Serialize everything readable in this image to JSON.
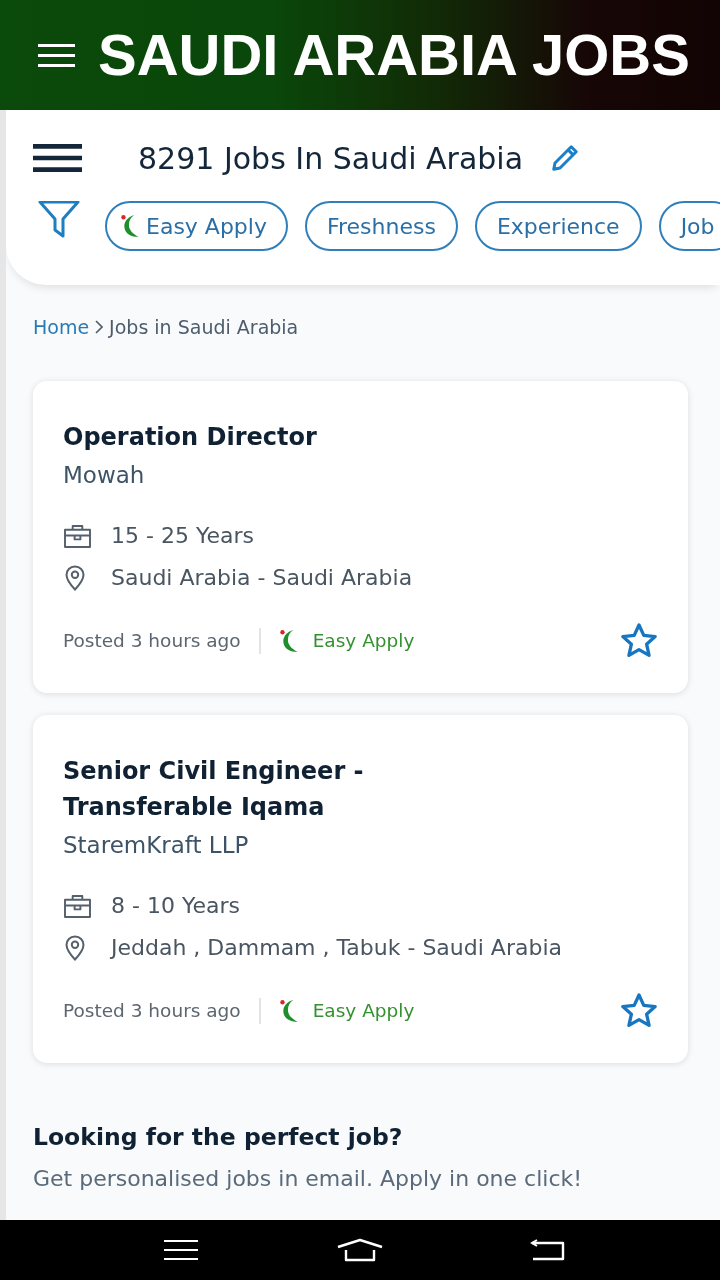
{
  "app_bar": {
    "title": "SAUDI ARABIA JOBS"
  },
  "header": {
    "title": "8291 Jobs In Saudi Arabia",
    "filters": [
      {
        "label": "Easy Apply",
        "kind": "easy-apply"
      },
      {
        "label": "Freshness",
        "kind": "plain"
      },
      {
        "label": "Experience",
        "kind": "plain"
      },
      {
        "label": "Job",
        "kind": "plain"
      }
    ]
  },
  "breadcrumb": [
    {
      "label": "Home",
      "kind": "link"
    },
    {
      "label": "Jobs in Saudi Arabia",
      "kind": "current"
    }
  ],
  "jobs": [
    {
      "title": "Operation Director",
      "company": "Mowah",
      "experience": "15 - 25 Years",
      "location": "Saudi Arabia - Saudi Arabia",
      "posted": "Posted 3 hours ago",
      "badge": "Easy Apply",
      "saved": false
    },
    {
      "title": "Senior Civil Engineer - Transferable Iqama",
      "company": "StaremKraft LLP",
      "experience": "8 - 10 Years",
      "location": "Jeddah , Dammam , Tabuk - Saudi Arabia",
      "posted": "Posted 3 hours ago",
      "badge": "Easy Apply",
      "saved": false
    }
  ],
  "promo": {
    "title": "Looking for the perfect job?",
    "text": "Get personalised jobs in email. Apply in one click!"
  }
}
